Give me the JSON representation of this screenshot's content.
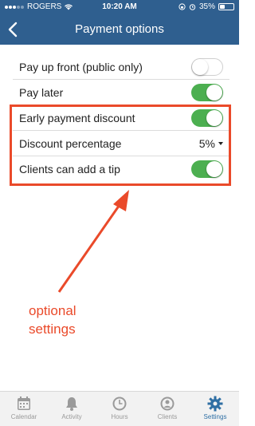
{
  "status_bar": {
    "carrier": "ROGERS",
    "time": "10:20 AM",
    "battery": "35%"
  },
  "nav": {
    "title": "Payment options"
  },
  "settings": [
    {
      "label": "Pay up front (public only)",
      "type": "toggle",
      "on": false
    },
    {
      "label": "Pay later",
      "type": "toggle",
      "on": true
    },
    {
      "label": "Early payment discount",
      "type": "toggle",
      "on": true
    },
    {
      "label": "Discount percentage",
      "type": "select",
      "value": "5%"
    },
    {
      "label": "Clients can add a tip",
      "type": "toggle",
      "on": true
    }
  ],
  "annotation": {
    "line1": "optional",
    "line2": "settings",
    "color": "#ea4a2a"
  },
  "tabs": [
    {
      "label": "Calendar",
      "icon": "calendar-icon",
      "active": false
    },
    {
      "label": "Activity",
      "icon": "bell-icon",
      "active": false
    },
    {
      "label": "Hours",
      "icon": "clock-icon",
      "active": false
    },
    {
      "label": "Clients",
      "icon": "person-icon",
      "active": false
    },
    {
      "label": "Settings",
      "icon": "gear-icon",
      "active": true
    }
  ],
  "colors": {
    "header": "#2f5f8f",
    "toggle_on": "#4caf50",
    "active_tab": "#2f6fa4",
    "inactive_tab": "#999999"
  }
}
